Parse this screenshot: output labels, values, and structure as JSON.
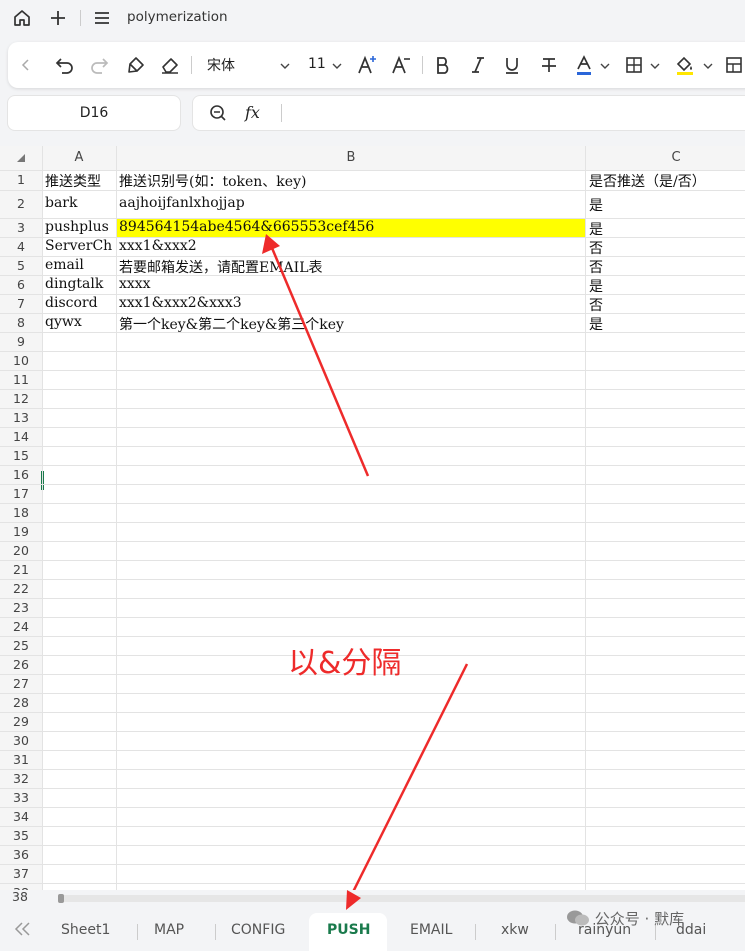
{
  "app": {
    "doc_title": "polymerization"
  },
  "toolbar": {
    "font_name": "宋体",
    "font_size": "11"
  },
  "name_box": "D16",
  "formula_icon": "fx",
  "columns": [
    "A",
    "B",
    "C"
  ],
  "rows": [
    {
      "n": "1",
      "a": "推送类型",
      "b": "推送识别号(如：token、key)",
      "c": "是否推送（是/否）"
    },
    {
      "n": "2",
      "a": "bark",
      "b": "aajhoijfanlxhojjap",
      "c": "是"
    },
    {
      "n": "3",
      "a": "pushplus",
      "b": "894564154abe4564&665553cef456",
      "c": "是"
    },
    {
      "n": "4",
      "a": "ServerCh",
      "b": "xxx1&xxx2",
      "c": "否"
    },
    {
      "n": "5",
      "a": "email",
      "b": "若要邮箱发送，请配置EMAIL表",
      "c": "否"
    },
    {
      "n": "6",
      "a": "dingtalk",
      "b": "xxxx",
      "c": "是"
    },
    {
      "n": "7",
      "a": "discord",
      "b": "xxx1&xxx2&xxx3",
      "c": "否"
    },
    {
      "n": "8",
      "a": "qywx",
      "b": "第一个key&第二个key&第三个key",
      "c": "是"
    }
  ],
  "empty_row_numbers": [
    "9",
    "10",
    "11",
    "12",
    "13",
    "14",
    "15",
    "16",
    "17",
    "18",
    "19",
    "20",
    "21",
    "22",
    "23",
    "24",
    "25",
    "26",
    "27",
    "28",
    "29",
    "30",
    "31",
    "32",
    "33",
    "34",
    "35",
    "36",
    "37",
    "38"
  ],
  "highlight_color": "#ffff00",
  "annotation": "以&分隔",
  "annotation_color": "#ee2b2b",
  "sheet_tabs": [
    "Sheet1",
    "MAP",
    "CONFIG",
    "PUSH",
    "EMAIL",
    "xkw",
    "rainyun",
    "ddai"
  ],
  "active_tab": "PUSH",
  "watermark": "公众号 · 默库"
}
